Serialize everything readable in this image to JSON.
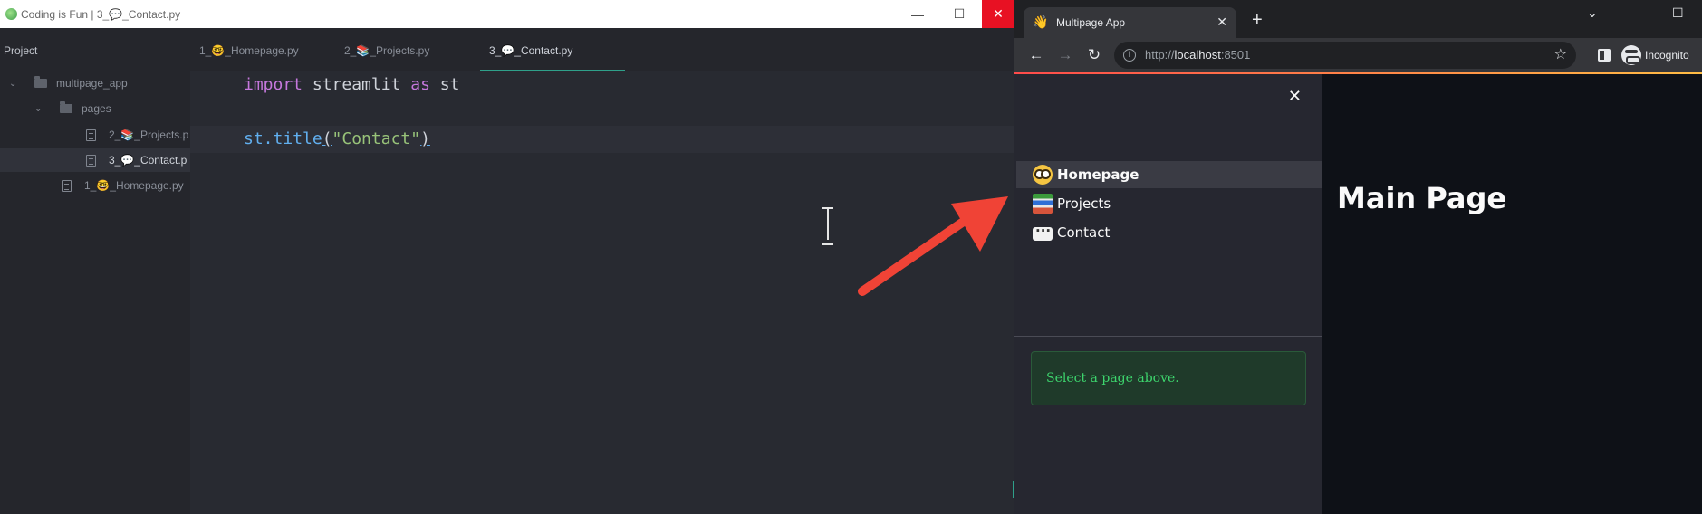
{
  "editor": {
    "window_title": "Coding is Fun | 3_💬_Contact.py",
    "controls": {
      "minimize": "—",
      "maximize": "☐",
      "close": "✕"
    },
    "project_label": "Project",
    "tabs": [
      {
        "label": "1_🤓_Homepage.py",
        "active": false
      },
      {
        "label": "2_📚_Projects.py",
        "active": false
      },
      {
        "label": "3_💬_Contact.py",
        "active": true
      }
    ],
    "tree": {
      "root": "multipage_app",
      "folder": "pages",
      "files": [
        "2_📚_Projects.p",
        "3_💬_Contact.p"
      ],
      "root_file": "1_🤓_Homepage.py"
    },
    "code": {
      "line1": {
        "kw_import": "import",
        "module": " streamlit ",
        "kw_as": "as",
        "alias": " st"
      },
      "line3": {
        "obj": "st.",
        "func": "title",
        "open": "(",
        "arg": "\"Contact\"",
        "close": ")"
      }
    }
  },
  "browser": {
    "tab_icon": "👋",
    "tab_title": "Multipage App",
    "tab_close": "✕",
    "new_tab": "+",
    "controls": {
      "chevron": "⌄",
      "minimize": "—",
      "maximize": "☐"
    },
    "nav": {
      "back": "←",
      "forward": "→",
      "reload": "↻"
    },
    "url": {
      "scheme": "http://",
      "host": "localhost",
      "port": ":8501"
    },
    "bookmark_icon": "☆",
    "incognito_label": "Incognito"
  },
  "streamlit": {
    "sidebar_close": "✕",
    "nav": [
      {
        "label": "Homepage",
        "icon": "nerd-face-icon",
        "active": true
      },
      {
        "label": "Projects",
        "icon": "books-icon",
        "active": false
      },
      {
        "label": "Contact",
        "icon": "speech-balloon-icon",
        "active": false
      }
    ],
    "alert": "Select a page above.",
    "main_title": "Main Page"
  },
  "colors": {
    "editor_bg": "#282a31",
    "streamlit_main_bg": "#0e1117",
    "streamlit_sidebar_bg": "#262730",
    "alert_text": "#3dd56d",
    "arrow": "#f04336",
    "close_red": "#e81123",
    "tab_accent": "#2fa08a"
  }
}
